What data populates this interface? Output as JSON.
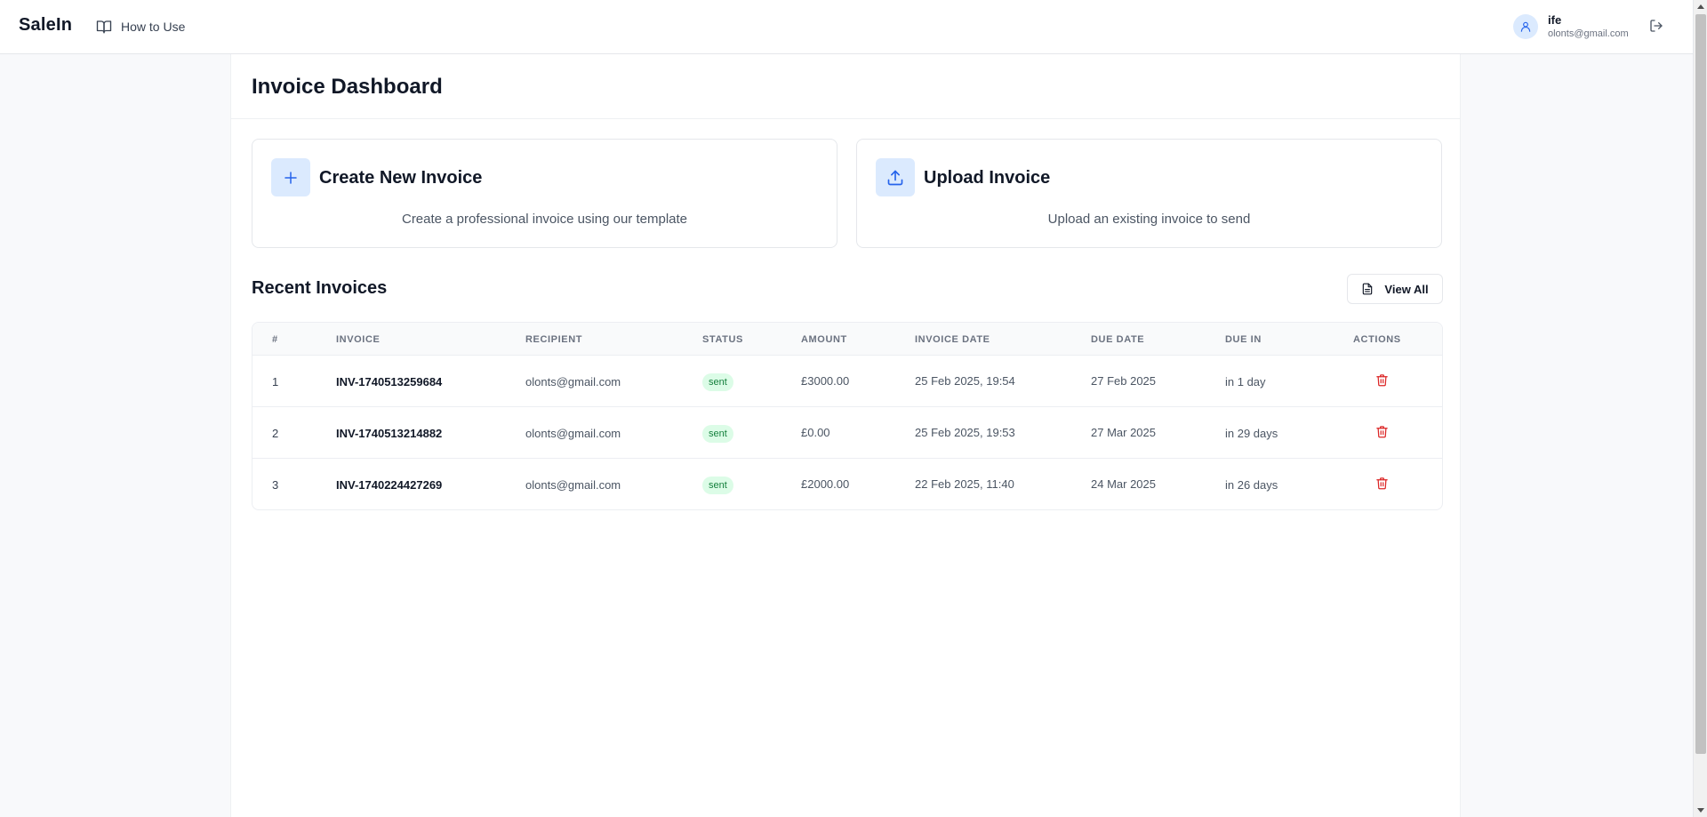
{
  "app": {
    "brand": "SaleIn"
  },
  "nav": {
    "how_to_use": "How to Use"
  },
  "user": {
    "name": "ife",
    "email": "olonts@gmail.com"
  },
  "page": {
    "title": "Invoice Dashboard"
  },
  "actions": {
    "create": {
      "title": "Create New Invoice",
      "description": "Create a professional invoice using our template"
    },
    "upload": {
      "title": "Upload Invoice",
      "description": "Upload an existing invoice to send"
    }
  },
  "recent": {
    "title": "Recent Invoices",
    "view_all": "View All",
    "columns": [
      "#",
      "INVOICE",
      "RECIPIENT",
      "STATUS",
      "AMOUNT",
      "INVOICE DATE",
      "DUE DATE",
      "DUE IN",
      "ACTIONS"
    ],
    "rows": [
      {
        "num": "1",
        "invoice": "INV-1740513259684",
        "recipient": "olonts@gmail.com",
        "status": "sent",
        "amount": "£3000.00",
        "invoice_date": "25 Feb 2025, 19:54",
        "due_date": "27 Feb 2025",
        "due_in": "in 1 day"
      },
      {
        "num": "2",
        "invoice": "INV-1740513214882",
        "recipient": "olonts@gmail.com",
        "status": "sent",
        "amount": "£0.00",
        "invoice_date": "25 Feb 2025, 19:53",
        "due_date": "27 Mar 2025",
        "due_in": "in 29 days"
      },
      {
        "num": "3",
        "invoice": "INV-1740224427269",
        "recipient": "olonts@gmail.com",
        "status": "sent",
        "amount": "£2000.00",
        "invoice_date": "22 Feb 2025, 11:40",
        "due_date": "24 Mar 2025",
        "due_in": "in 26 days"
      }
    ]
  },
  "colors": {
    "accent_bg": "#dbeafe",
    "accent": "#2563eb",
    "status_sent_bg": "#dcfce7",
    "status_sent_text": "#15803d",
    "danger": "#dc2626"
  },
  "icons": [
    "book-open-icon",
    "user-icon",
    "logout-icon",
    "plus-icon",
    "upload-icon",
    "document-icon",
    "trash-icon"
  ]
}
